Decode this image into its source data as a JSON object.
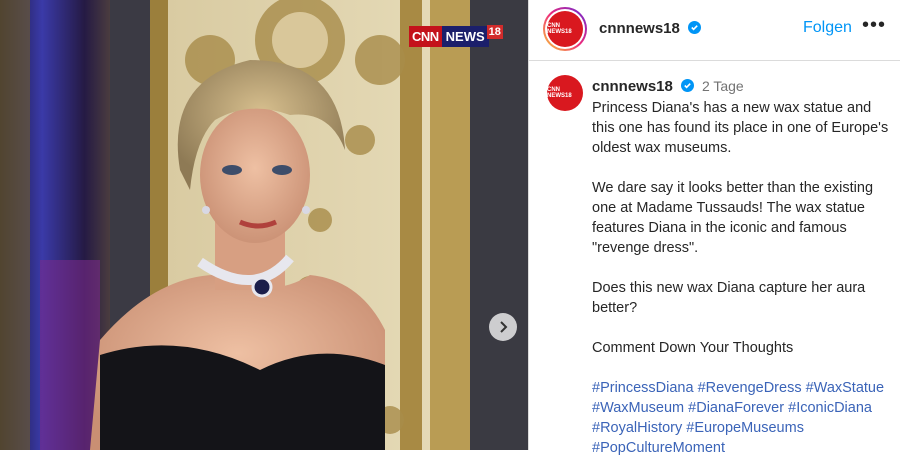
{
  "watermark": {
    "part1": "CNN",
    "part2": "NEWS",
    "part3": "18"
  },
  "header": {
    "avatar_text": "CNN NEWS18",
    "username": "cnnnews18",
    "follow_label": "Folgen",
    "more_label": "•••"
  },
  "caption": {
    "avatar_text": "CNN NEWS18",
    "username": "cnnnews18",
    "time": "2 Tage",
    "p1": "Princess Diana's has a new wax statue and this one has found its place in one of Europe's oldest wax museums.",
    "p2": "We dare say it looks better than the existing one at Madame Tussauds! The wax statue features Diana in the iconic and famous \"revenge dress\".",
    "p3": "Does this new wax Diana capture her aura better?",
    "p4": "Comment Down Your Thoughts",
    "hashtags": [
      "#PrincessDiana",
      "#RevengeDress",
      "#WaxStatue",
      "#WaxMuseum",
      "#DianaForever",
      "#IconicDiana",
      "#RoyalHistory",
      "#EuropeMuseums",
      "#PopCultureMoment"
    ]
  },
  "icons": {
    "next": "chevron-right-icon",
    "verified": "verified-badge-icon"
  },
  "colors": {
    "link": "#0095f6",
    "hashtag": "#3b64b8",
    "brand_red": "#d9181f"
  }
}
